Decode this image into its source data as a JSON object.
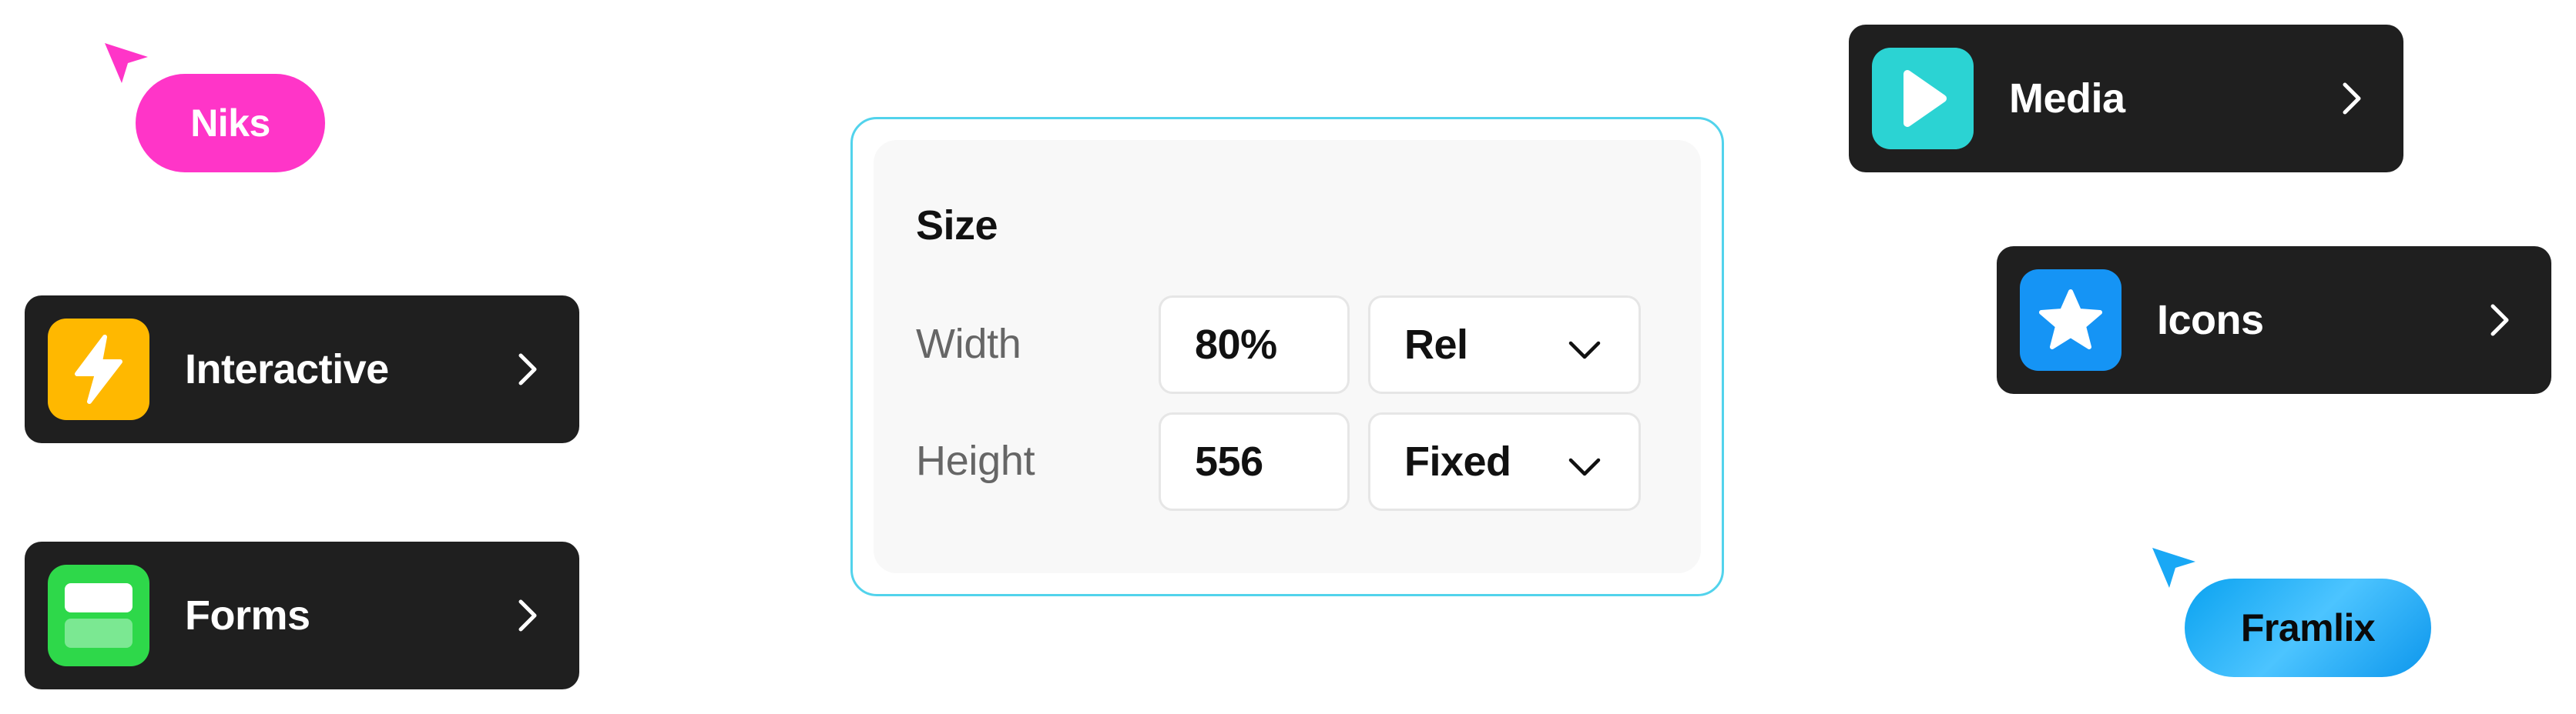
{
  "cursors": [
    {
      "label": "Niks",
      "color": "#ff35c8",
      "text_color": "#ffffff",
      "icon": "cursor-arrow-icon"
    },
    {
      "label": "Framlix",
      "color": "#19a8f5",
      "text_color": "#0a0a0a",
      "icon": "cursor-arrow-icon"
    }
  ],
  "nav_cards": [
    {
      "id": "interactive",
      "label": "Interactive",
      "icon": "lightning-icon",
      "icon_bg": "#ffb800"
    },
    {
      "id": "forms",
      "label": "Forms",
      "icon": "form-layout-icon",
      "icon_bg": "#2ed84a"
    },
    {
      "id": "media",
      "label": "Media",
      "icon": "play-icon",
      "icon_bg": "#2bd3d3"
    },
    {
      "id": "icons",
      "label": "Icons",
      "icon": "star-icon",
      "icon_bg": "#1594f5"
    }
  ],
  "size_panel": {
    "title": "Size",
    "accent_border": "#52d3ec",
    "rows": [
      {
        "label": "Width",
        "value": "80%",
        "unit": "Rel"
      },
      {
        "label": "Height",
        "value": "556",
        "unit": "Fixed"
      }
    ]
  }
}
